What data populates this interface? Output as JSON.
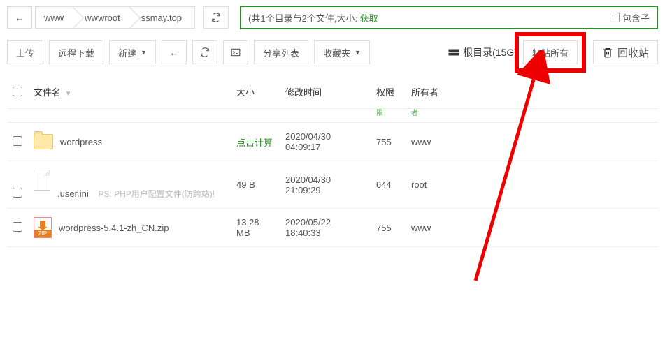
{
  "breadcrumb": [
    "www",
    "wwwroot",
    "ssmay.top"
  ],
  "summary": {
    "prefix": "(共1个目录与2个文件,大小: ",
    "suffix_green": "获取",
    "include_sub": "包含子"
  },
  "toolbar": {
    "upload": "上传",
    "remote_dl": "远程下载",
    "new": "新建",
    "share": "分享列表",
    "favorites": "收藏夹",
    "disk": "根目录(15G)",
    "paste_all": "粘贴所有",
    "trash": "回收站"
  },
  "headers": {
    "name": "文件名",
    "size": "大小",
    "mtime": "修改时间",
    "perm": "权限",
    "owner": "所有者"
  },
  "rows": [
    {
      "name": "wordpress",
      "type": "folder",
      "size": "点击计算",
      "size_green": true,
      "mtime": "2020/04/30 04:09:17",
      "perm": "755",
      "owner": "www",
      "note": ""
    },
    {
      "name": ".user.ini",
      "type": "file",
      "size": "49 B",
      "size_green": false,
      "mtime": "2020/04/30 21:09:29",
      "perm": "644",
      "owner": "root",
      "note": "PS: PHP用户配置文件(防跨站)!"
    },
    {
      "name": "wordpress-5.4.1-zh_CN.zip",
      "type": "zip",
      "size": "13.28 MB",
      "size_green": false,
      "mtime": "2020/05/22 18:40:33",
      "perm": "755",
      "owner": "www",
      "note": ""
    }
  ]
}
